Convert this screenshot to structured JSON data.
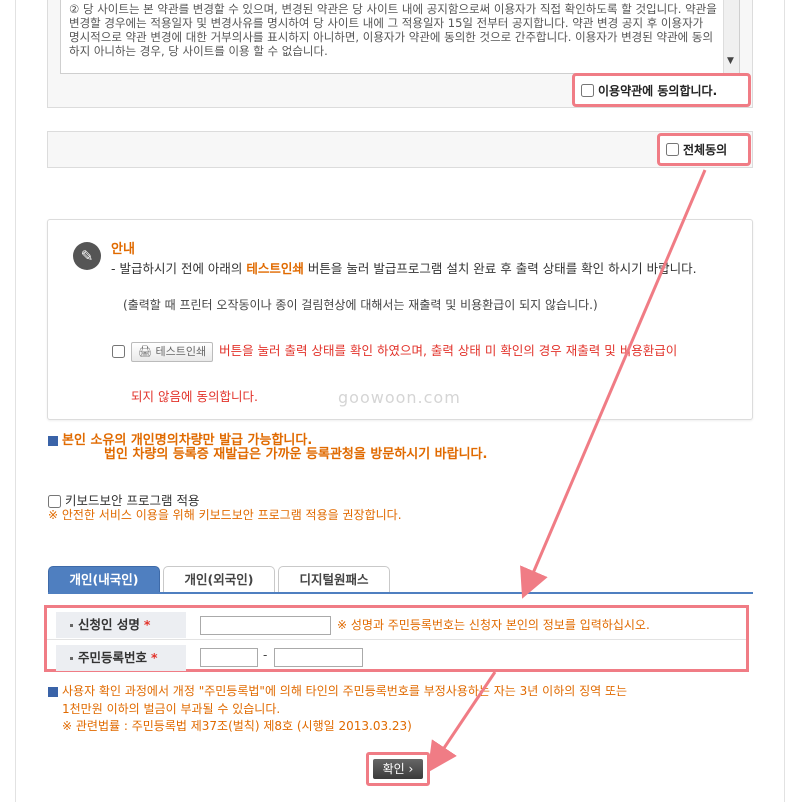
{
  "terms": {
    "text": "② 당 사이트는 본 약관를 변경할 수 있으며, 변경된 약관은 당 사이트 내에 공지함으로써 이용자가 직접 확인하도록 할 것입니다. 약관을 변경할 경우에는 적용일자 및 변경사유를 명시하여 당 사이트 내에 그 적용일자 15일 전부터 공지합니다. 약관 변경 공지 후 이용자가 명시적으로 약관 변경에 대한 거부의사를 표시하지 아니하면, 이용자가 약관에 동의한 것으로 간주합니다. 이용자가 변경된 약관에 동의하지 아니하는 경우, 당 사이트를 이용 할 수 없습니다.",
    "agree_label": "이용약관에 동의합니다."
  },
  "agree_all_label": "전체동의",
  "notice": {
    "title": "안내",
    "line1_pre": "- 발급하시기 전에 아래의 ",
    "line1_highlight": "테스트인쇄",
    "line1_post": " 버튼을 눌러 발급프로그램 설치 완료 후 출력 상태를 확인 하시기 바랍니다.",
    "line2": "(출력할 때 프린터 오작동이나 종이 걸림현상에 대해서는 재출력 및 비용환급이 되지 않습니다.)",
    "test_button": "테스트인쇄",
    "test_text": "버튼을 눌러 출력 상태를 확인 하였으며, 출력 상태 미 확인의 경우 재출력 및 비용환급이",
    "test_text2": "되지 않음에 동의합니다.",
    "watermark": "goowoon.com"
  },
  "ownership": {
    "line1": "본인 소유의 개인명의차량만 발급 가능합니다.",
    "line2": "법인 차량의 등록증 재발급은 가까운 등록관청을 방문하시기 바랍니다."
  },
  "keyboard": {
    "label": "키보드보안 프로그램 적용",
    "warning": "※ 안전한 서비스 이용을 위해 키보드보안 프로그램 적용을 권장합니다."
  },
  "tabs": [
    {
      "label": "개인(내국인)"
    },
    {
      "label": "개인(외국인)"
    },
    {
      "label": "디지털원패스"
    }
  ],
  "form": {
    "name_label": "신청인 성명",
    "id_label": "주민등록번호",
    "required_mark": "*",
    "hint": "※ 성명과 주민등록번호는 신청자 본인의 정보를 입력하십시오.",
    "dash": "-"
  },
  "warnings": {
    "line1": "사용자 확인 과정에서 개정 \"주민등록법\"에 의해 타인의 주민등록번호를 부정사용하는 자는 3년 이하의 징역 또는",
    "line2": "1천만원 이하의 벌금이 부과될 수 있습니다.",
    "line3": "※ 관련법률 : 주민등록법 제37조(벌칙) 제8호 (시행일 2013.03.23)"
  },
  "confirm_label": "확인 ›",
  "colors": {
    "highlight": "#f07c85",
    "accent": "#4f7fc0",
    "orange": "#e06a00",
    "red": "#e2332b"
  }
}
